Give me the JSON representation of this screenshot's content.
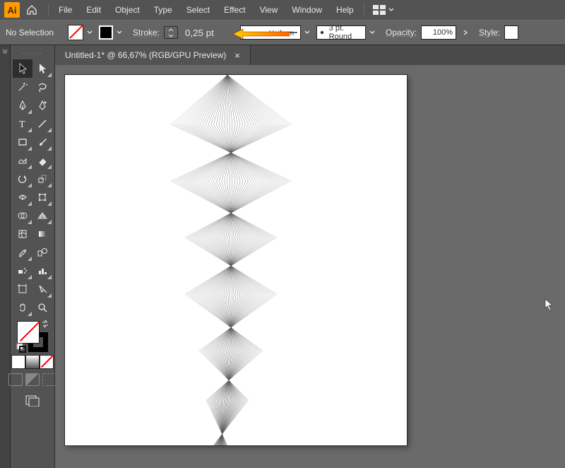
{
  "app": {
    "logo": "Ai"
  },
  "menu": {
    "file": "File",
    "edit": "Edit",
    "object": "Object",
    "type": "Type",
    "select": "Select",
    "effect": "Effect",
    "view": "View",
    "window": "Window",
    "help": "Help"
  },
  "ctrl": {
    "noSelection": "No Selection",
    "strokeLabel": "Stroke:",
    "strokeValue": "0,25 pt",
    "profile": "Uniform",
    "brush": "3 pt. Round",
    "opacityLabel": "Opacity:",
    "opacityValue": "100%",
    "styleLabel": "Style:"
  },
  "doc": {
    "tab": "Untitled-1* @ 66,67% (RGB/GPU Preview)",
    "close": "×"
  },
  "swatches": {
    "white": "#ffffff",
    "gray": "#888888",
    "none": "none"
  }
}
